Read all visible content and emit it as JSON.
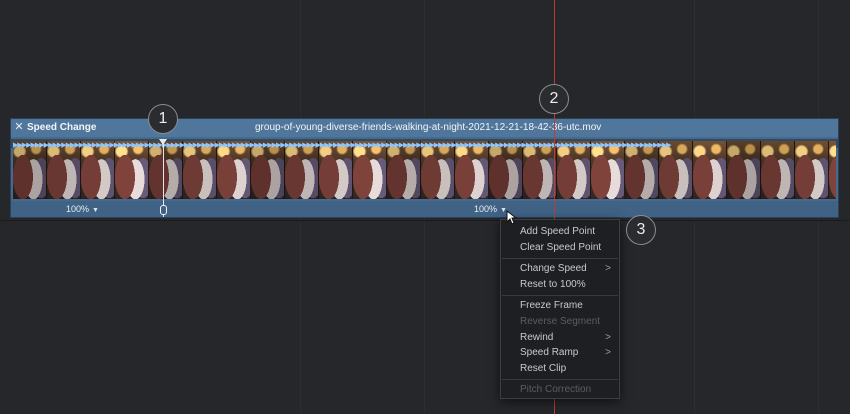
{
  "clip": {
    "effect_title": "Speed Change",
    "filename": "group-of-young-diverse-friends-walking-at-night-2021-12-21-18-42-36-utc.mov",
    "speed_left": "100%",
    "speed_right": "100%"
  },
  "badges": {
    "one": "1",
    "two": "2",
    "three": "3"
  },
  "menu": {
    "add_speed_point": "Add Speed Point",
    "clear_speed_point": "Clear Speed Point",
    "change_speed": "Change Speed",
    "reset_to_100": "Reset to 100%",
    "freeze_frame": "Freeze Frame",
    "reverse_segment": "Reverse Segment",
    "rewind": "Rewind",
    "speed_ramp": "Speed Ramp",
    "reset_clip": "Reset Clip",
    "pitch_correction": "Pitch Correction",
    "submenu_glyph": ">"
  },
  "colors": {
    "background": "#26272b",
    "clip_header": "#50779b",
    "clip_body": "#466a8e",
    "playhead": "#c23a36",
    "menu_bg": "#1e1f22"
  },
  "icons": {
    "close": "close-icon",
    "caret": "caret-down-icon",
    "cursor": "mouse-pointer-icon"
  }
}
